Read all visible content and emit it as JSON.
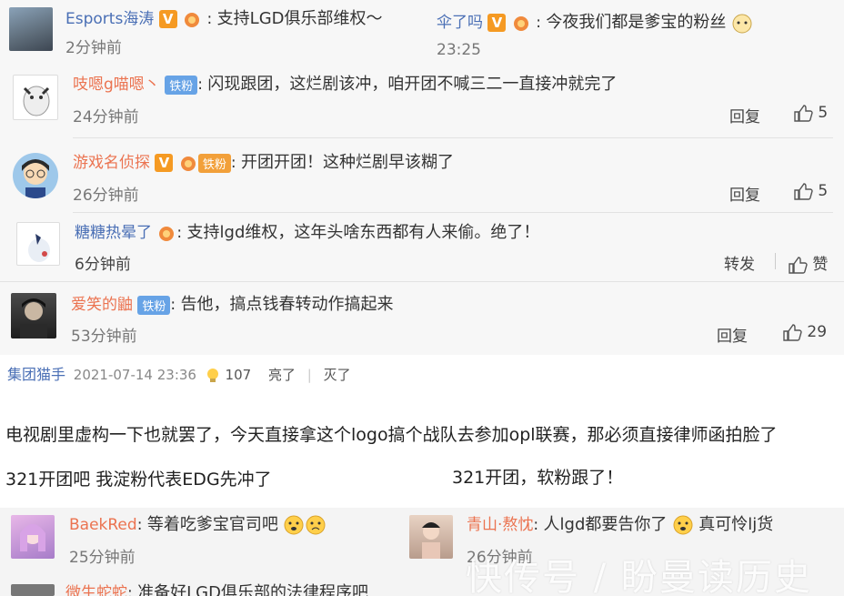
{
  "top_comments": [
    {
      "user": "Esports海涛",
      "text": "支持LGD俱乐部维权～",
      "time": "2分钟前"
    },
    {
      "user": "伞了吗",
      "text": "今夜我们都是爹宝的粉丝",
      "time": "23:25"
    }
  ],
  "comments": [
    {
      "user": "吱嗯g喵嗯丶",
      "badge": "铁粉",
      "text": "闪现跟团，这烂剧该冲，咱开团不喊三二一直接冲就完了",
      "time": "24分钟前",
      "reply": "回复",
      "likes": "5"
    },
    {
      "user": "游戏名侦探",
      "badge": "铁粉",
      "text": "开团开团！这种烂剧早该糊了",
      "time": "26分钟前",
      "reply": "回复",
      "likes": "5"
    },
    {
      "user": "糖糖热晕了",
      "text": "支持lgd维权，这年头啥东西都有人来偷。绝了！",
      "time": "6分钟前",
      "reply": "转发",
      "likes": "赞"
    },
    {
      "user": "爱笑的鼬",
      "badge": "铁粉",
      "text": "告他，搞点钱春转动作搞起来",
      "time": "53分钟前",
      "reply": "回复",
      "likes": "29"
    }
  ],
  "post": {
    "user": "集团猫手",
    "date": "2021-07-14 23:36",
    "bulb_count": "107",
    "liang": "亮了",
    "mie": "灭了",
    "body": "电视剧里虚构一下也就罢了，今天直接拿这个logo搞个战队去参加opl联赛，那必须直接律师函拍脸了",
    "line_left": "321开团吧 我淀粉代表EDG先冲了",
    "line_right": "321开团，软粉跟了！"
  },
  "bottom_comments": [
    {
      "user": "BaekRed",
      "text": "等着吃爹宝官司吧",
      "time": "25分钟前"
    },
    {
      "user": "青山·熬忱",
      "text": "人lgd都要告你了",
      "text2": "真可怜lj货",
      "time": "26分钟前"
    },
    {
      "user": "微生蛇蛇",
      "text": "准备好LGD俱乐部的法律程序吧"
    }
  ],
  "watermark": "快传号 / 盼曼读历史",
  "colors": {
    "name_orange": "#eb7350",
    "name_blue": "#4a6fb5",
    "badge_blue": "#67a3e6",
    "v_orange": "#f59a23"
  }
}
